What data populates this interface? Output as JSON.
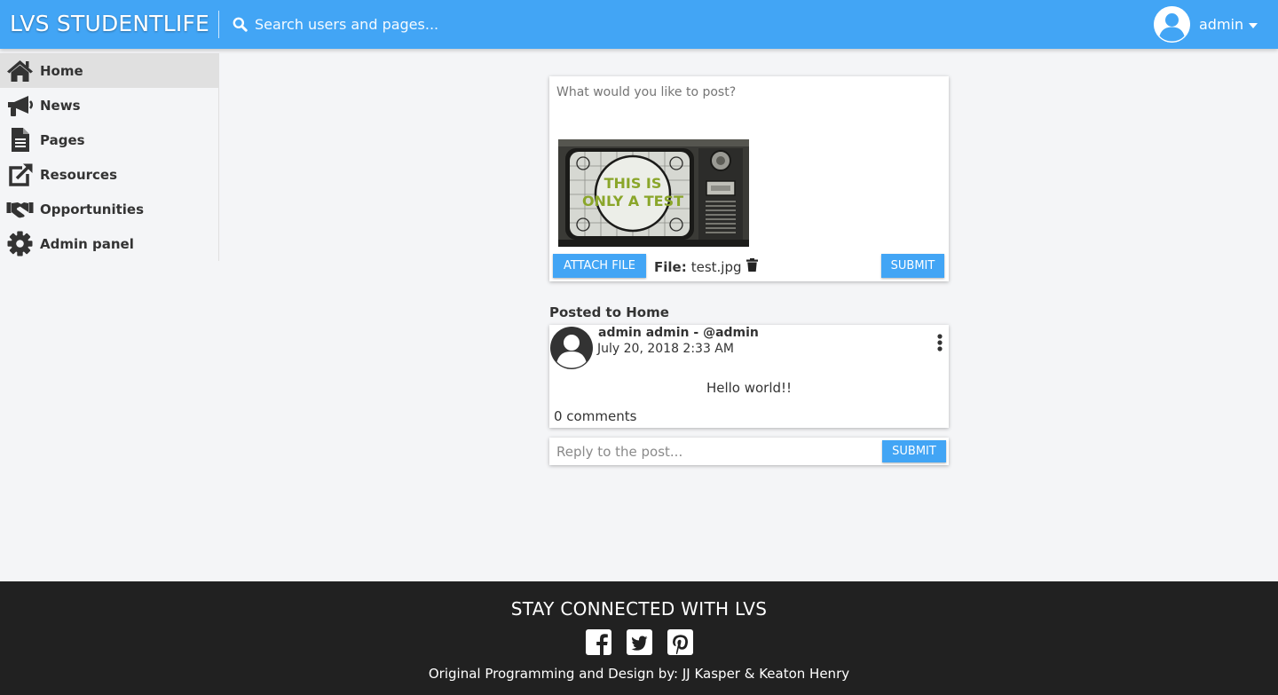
{
  "header": {
    "brand": "LVS STUDENTLIFE",
    "search_placeholder": "Search users and pages...",
    "user_name": "admin",
    "accent_color": "#42a5f5"
  },
  "sidebar": {
    "items": [
      {
        "label": "Home",
        "icon": "home-icon",
        "active": true
      },
      {
        "label": "News",
        "icon": "bullhorn-icon",
        "active": false
      },
      {
        "label": "Pages",
        "icon": "file-text-icon",
        "active": false
      },
      {
        "label": "Resources",
        "icon": "external-link-icon",
        "active": false
      },
      {
        "label": "Opportunities",
        "icon": "handshake-icon",
        "active": false
      },
      {
        "label": "Admin panel",
        "icon": "gear-icon",
        "active": false
      }
    ]
  },
  "composer": {
    "placeholder": "What would you like to post?",
    "attach_label": "ATTACH FILE",
    "file_prefix": "File:",
    "file_name": "test.jpg",
    "submit_label": "SUBMIT",
    "preview_text_line1": "THIS IS",
    "preview_text_line2": "ONLY A TEST"
  },
  "feed": {
    "posted_to": "Posted to Home",
    "post": {
      "author": "admin admin - @admin",
      "date": "July 20, 2018 2:33 AM",
      "body": "Hello world!!",
      "comments": "0 comments"
    },
    "reply_placeholder": "Reply to the post...",
    "reply_submit_label": "SUBMIT"
  },
  "footer": {
    "title": "STAY CONNECTED WITH LVS",
    "credit": "Original Programming and Design by: JJ Kasper & Keaton Henry",
    "background": "#212121"
  }
}
